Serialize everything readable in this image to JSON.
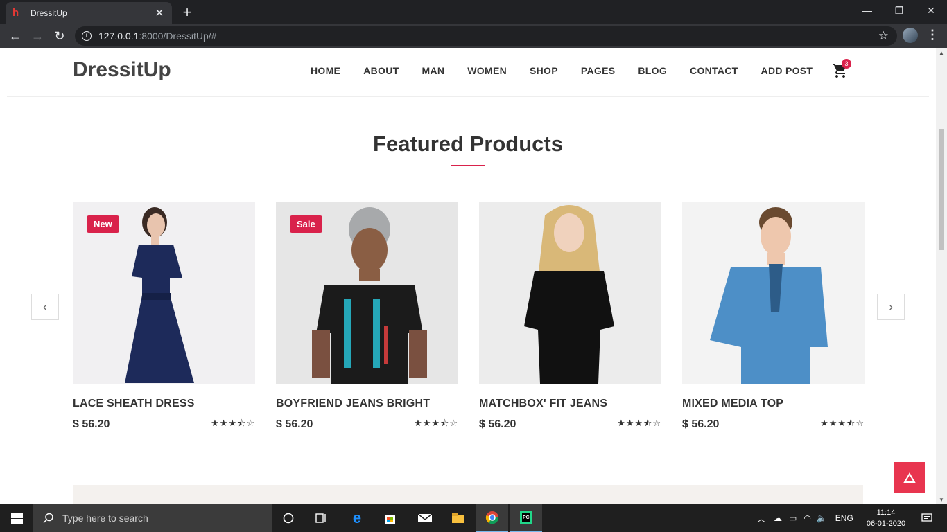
{
  "browser": {
    "tab_title": "DressitUp",
    "url_host": "127.0.0.1",
    "url_rest": ":8000/DressitUp/#"
  },
  "site": {
    "brand": "DressitUp",
    "menu": [
      "HOME",
      "ABOUT",
      "MAN",
      "WOMEN",
      "SHOP",
      "PAGES",
      "BLOG",
      "CONTACT",
      "ADD POST"
    ],
    "cart_count": "3"
  },
  "featured": {
    "title": "Featured Products",
    "products": [
      {
        "name": "LACE SHEATH DRESS",
        "price": "$ 56.20",
        "badge": "New",
        "rating": "★★★⯪☆"
      },
      {
        "name": "BOYFRIEND JEANS BRIGHT",
        "price": "$ 56.20",
        "badge": "Sale",
        "rating": "★★★⯪☆"
      },
      {
        "name": "MATCHBOX' FIT JEANS",
        "price": "$ 56.20",
        "badge": "",
        "rating": "★★★⯪☆"
      },
      {
        "name": "MIXED MEDIA TOP",
        "price": "$ 56.20",
        "badge": "",
        "rating": "★★★⯪☆"
      }
    ]
  },
  "taskbar": {
    "search_placeholder": "Type here to search",
    "lang": "ENG",
    "time": "11:14",
    "date": "06-01-2020"
  },
  "colors": {
    "accent": "#d9224b",
    "to_top": "#e8354f"
  }
}
